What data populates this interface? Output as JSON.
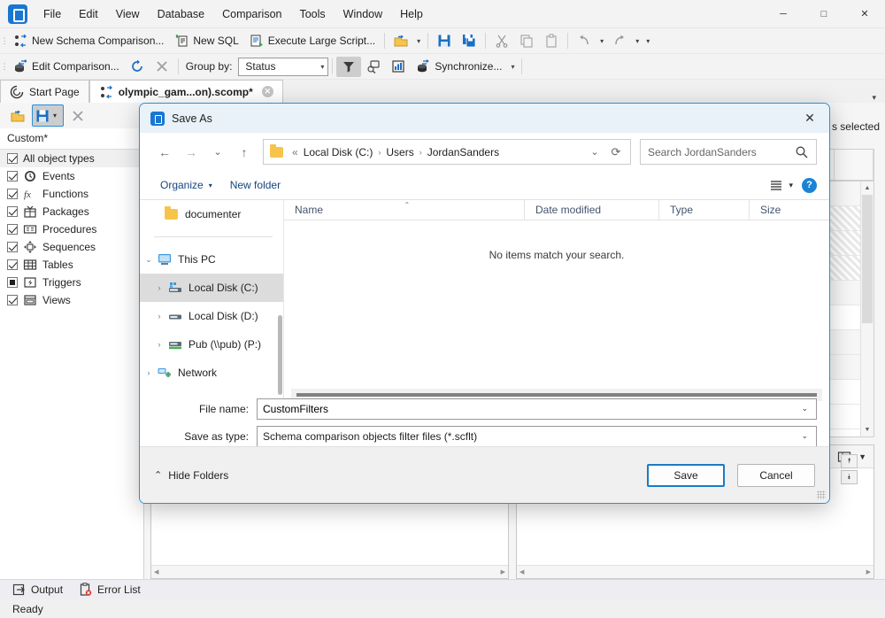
{
  "app": {
    "menus": [
      "File",
      "Edit",
      "View",
      "Database",
      "Comparison",
      "Tools",
      "Window",
      "Help"
    ],
    "window_controls": {
      "minimize": "─",
      "maximize": "□",
      "close": "✕"
    }
  },
  "toolbar_main": {
    "new_schema_comparison": "New Schema Comparison...",
    "new_sql": "New SQL",
    "execute_large_script": "Execute Large Script...",
    "dropdown_caret": "▾"
  },
  "toolbar_second": {
    "edit_comparison": "Edit Comparison...",
    "group_by_label": "Group by:",
    "group_by_value": "Status",
    "synchronize": "Synchronize...",
    "dropdown_caret": "▾"
  },
  "tabs": [
    {
      "label": "Start Page",
      "active": false
    },
    {
      "label": "olympic_gam...on).scomp*",
      "active": true,
      "close": "✕"
    }
  ],
  "tab_overflow": "▾",
  "left_panel": {
    "preset": "Custom*",
    "items": [
      {
        "label": "All object types",
        "state": "checked",
        "icon": ""
      },
      {
        "label": "Events",
        "state": "checked",
        "icon": "clock-icon"
      },
      {
        "label": "Functions",
        "state": "checked",
        "icon": "fx-icon"
      },
      {
        "label": "Packages",
        "state": "checked",
        "icon": "package-icon"
      },
      {
        "label": "Procedures",
        "state": "checked",
        "icon": "procedure-icon"
      },
      {
        "label": "Sequences",
        "state": "checked",
        "icon": "sequence-icon"
      },
      {
        "label": "Tables",
        "state": "checked",
        "icon": "table-icon"
      },
      {
        "label": "Triggers",
        "state": "partial",
        "icon": "trigger-icon"
      },
      {
        "label": "Views",
        "state": "checked",
        "icon": "view-icon"
      }
    ]
  },
  "right_panel": {
    "selection_text": "s selected"
  },
  "dialog": {
    "title": "Save As",
    "close": "✕",
    "nav": {
      "back": "←",
      "forward": "→",
      "recent": "⌄",
      "up": "↑",
      "refresh": "⟳",
      "history_caret": "⌄"
    },
    "breadcrumb": {
      "prefix": "«",
      "items": [
        "Local Disk (C:)",
        "Users",
        "JordanSanders"
      ],
      "separator": "›"
    },
    "search": {
      "placeholder": "Search JordanSanders",
      "value": "",
      "icon": "search-icon"
    },
    "organize": "Organize",
    "organize_caret": "▾",
    "new_folder": "New folder",
    "view_caret": "▾",
    "help": "?",
    "tree": [
      {
        "label": "documenter",
        "icon": "folder-icon",
        "indent": 2,
        "chevron": "",
        "selected": false
      },
      {
        "label": "This PC",
        "icon": "pc-icon",
        "indent": 0,
        "chevron": "⌄",
        "selected": false
      },
      {
        "label": "Local Disk (C:)",
        "icon": "drive-c-icon",
        "indent": 1,
        "chevron": "›",
        "selected": true
      },
      {
        "label": "Local Disk (D:)",
        "icon": "drive-icon",
        "indent": 1,
        "chevron": "›",
        "selected": false
      },
      {
        "label": "Pub (\\\\pub) (P:)",
        "icon": "network-drive-icon",
        "indent": 1,
        "chevron": "›",
        "selected": false
      },
      {
        "label": "Network",
        "icon": "network-icon",
        "indent": 0,
        "chevron": "›",
        "selected": false
      }
    ],
    "columns": [
      {
        "label": "Name",
        "sorted": true
      },
      {
        "label": "Date modified",
        "sorted": false
      },
      {
        "label": "Type",
        "sorted": false
      },
      {
        "label": "Size",
        "sorted": false
      }
    ],
    "sort_caret": "⌃",
    "empty_message": "No items match your search.",
    "file_name_label": "File name:",
    "file_name_value": "CustomFilters",
    "save_as_type_label": "Save as type:",
    "save_as_type_value": "Schema comparison objects filter files (*.scflt)",
    "field_caret": "⌄",
    "hide_folders": "Hide Folders",
    "hide_folders_caret": "⌃",
    "save_button": "Save",
    "cancel_button": "Cancel"
  },
  "status": {
    "tabs": [
      {
        "label": "Output",
        "icon": "output-icon"
      },
      {
        "label": "Error List",
        "icon": "error-list-icon"
      }
    ],
    "message": "Ready"
  },
  "colors": {
    "accent": "#1976d2",
    "dialog_border": "#2b8fd6",
    "title_bg": "#e8f2f8"
  }
}
